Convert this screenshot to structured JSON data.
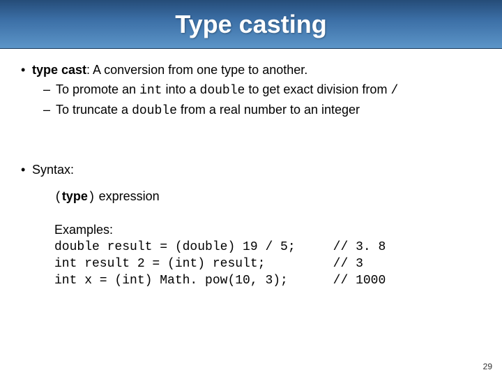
{
  "title": "Type casting",
  "bullet1": {
    "term": "type cast",
    "def": ": A conversion from one type to another.",
    "sub1_a": "To promote an ",
    "sub1_b": "int",
    "sub1_c": " into a ",
    "sub1_d": "double",
    "sub1_e": " to get exact division from ",
    "sub1_f": "/",
    "sub2_a": "To truncate a ",
    "sub2_b": "double",
    "sub2_c": " from a real number to an integer"
  },
  "bullet2": "Syntax:",
  "syntax": {
    "open": "(",
    "type": "type",
    "close": ")",
    "expr": " expression"
  },
  "examples": {
    "heading": "Examples:",
    "line1": "double result = (double) 19 / 5;     // 3. 8",
    "line2": "int result 2 = (int) result;         // 3",
    "line3": "int x = (int) Math. pow(10, 3);      // 1000"
  },
  "page": "29"
}
